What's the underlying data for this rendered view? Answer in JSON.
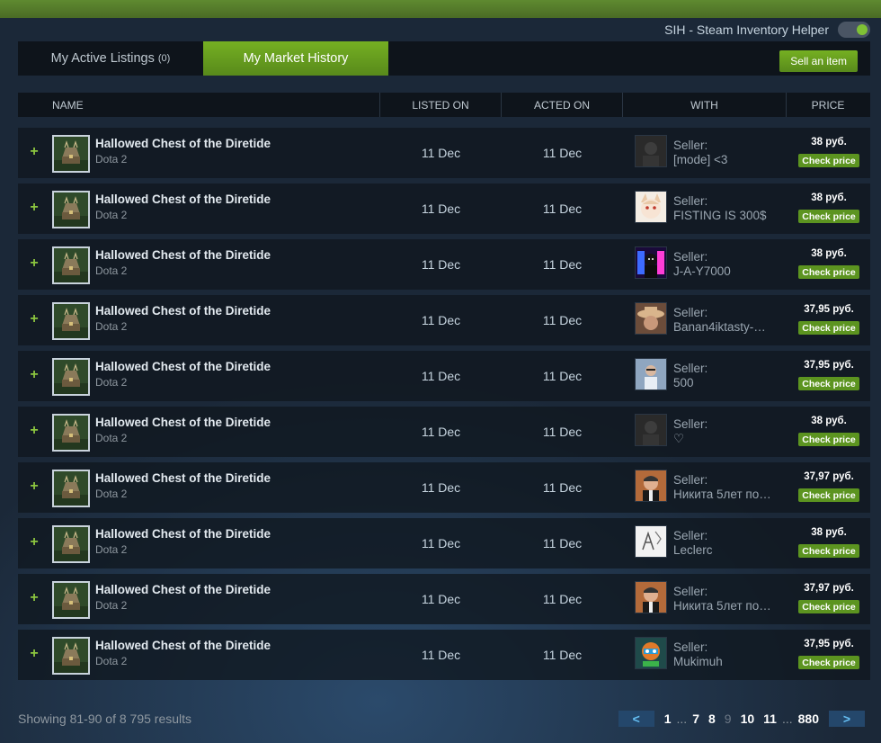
{
  "sih": {
    "label": "SIH - Steam Inventory Helper",
    "enabled": true
  },
  "tabs": [
    {
      "label": "My Active Listings",
      "count": "(0)",
      "active": false
    },
    {
      "label": "My Market History",
      "active": true
    }
  ],
  "sell_button": "Sell an item",
  "columns": {
    "name": "NAME",
    "listed": "LISTED ON",
    "acted": "ACTED ON",
    "with": "WITH",
    "price": "PRICE"
  },
  "rows": [
    {
      "expand": "+",
      "item": "Hallowed Chest of the Diretide",
      "game": "Dota 2",
      "listed": "11 Dec",
      "acted": "11 Dec",
      "seller_label": "Seller:",
      "seller": "[mode] <3",
      "price": "38 руб.",
      "check": "Check price",
      "avatar": "dark-avatar"
    },
    {
      "expand": "+",
      "item": "Hallowed Chest of the Diretide",
      "game": "Dota 2",
      "listed": "11 Dec",
      "acted": "11 Dec",
      "seller_label": "Seller:",
      "seller": "FISTING IS 300$",
      "price": "38 руб.",
      "check": "Check price",
      "avatar": "anime-girl-avatar"
    },
    {
      "expand": "+",
      "item": "Hallowed Chest of the Diretide",
      "game": "Dota 2",
      "listed": "11 Dec",
      "acted": "11 Dec",
      "seller_label": "Seller:",
      "seller": "J-A-Y7000",
      "price": "38 руб.",
      "check": "Check price",
      "avatar": "neon-avatar"
    },
    {
      "expand": "+",
      "item": "Hallowed Chest of the Diretide",
      "game": "Dota 2",
      "listed": "11 Dec",
      "acted": "11 Dec",
      "seller_label": "Seller:",
      "seller": "Banan4iktasty-…",
      "price": "37,95 руб.",
      "check": "Check price",
      "avatar": "cowboy-avatar"
    },
    {
      "expand": "+",
      "item": "Hallowed Chest of the Diretide",
      "game": "Dota 2",
      "listed": "11 Dec",
      "acted": "11 Dec",
      "seller_label": "Seller:",
      "seller": "500",
      "price": "37,95 руб.",
      "check": "Check price",
      "avatar": "photo-avatar"
    },
    {
      "expand": "+",
      "item": "Hallowed Chest of the Diretide",
      "game": "Dota 2",
      "listed": "11 Dec",
      "acted": "11 Dec",
      "seller_label": "Seller:",
      "seller": "♡",
      "price": "38 руб.",
      "check": "Check price",
      "avatar": "dark-avatar"
    },
    {
      "expand": "+",
      "item": "Hallowed Chest of the Diretide",
      "game": "Dota 2",
      "listed": "11 Dec",
      "acted": "11 Dec",
      "seller_label": "Seller:",
      "seller": "Никита 5лет по…",
      "price": "37,97 руб.",
      "check": "Check price",
      "avatar": "man-avatar"
    },
    {
      "expand": "+",
      "item": "Hallowed Chest of the Diretide",
      "game": "Dota 2",
      "listed": "11 Dec",
      "acted": "11 Dec",
      "seller_label": "Seller:",
      "seller": "Leclerc",
      "price": "38 руб.",
      "check": "Check price",
      "avatar": "sketch-avatar"
    },
    {
      "expand": "+",
      "item": "Hallowed Chest of the Diretide",
      "game": "Dota 2",
      "listed": "11 Dec",
      "acted": "11 Dec",
      "seller_label": "Seller:",
      "seller": "Никита 5лет по…",
      "price": "37,97 руб.",
      "check": "Check price",
      "avatar": "man-avatar"
    },
    {
      "expand": "+",
      "item": "Hallowed Chest of the Diretide",
      "game": "Dota 2",
      "listed": "11 Dec",
      "acted": "11 Dec",
      "seller_label": "Seller:",
      "seller": "Mukimuh",
      "price": "37,95 руб.",
      "check": "Check price",
      "avatar": "robot-avatar"
    }
  ],
  "footer": {
    "showing": "Showing 81-90 of 8 795 results"
  },
  "pager": {
    "prev": "<",
    "next": ">",
    "pages": [
      {
        "label": "1",
        "current": false
      },
      {
        "label": "...",
        "ellipsis": true
      },
      {
        "label": "7",
        "current": false
      },
      {
        "label": "8",
        "current": false
      },
      {
        "label": "9",
        "current": true
      },
      {
        "label": "10",
        "current": false
      },
      {
        "label": "11",
        "current": false
      },
      {
        "label": "...",
        "ellipsis": true
      },
      {
        "label": "880",
        "current": false
      }
    ]
  },
  "colors": {
    "accent": "#75b022",
    "background": "#1b2838",
    "panel": "#0e141b",
    "check_button": "#5c9420"
  }
}
